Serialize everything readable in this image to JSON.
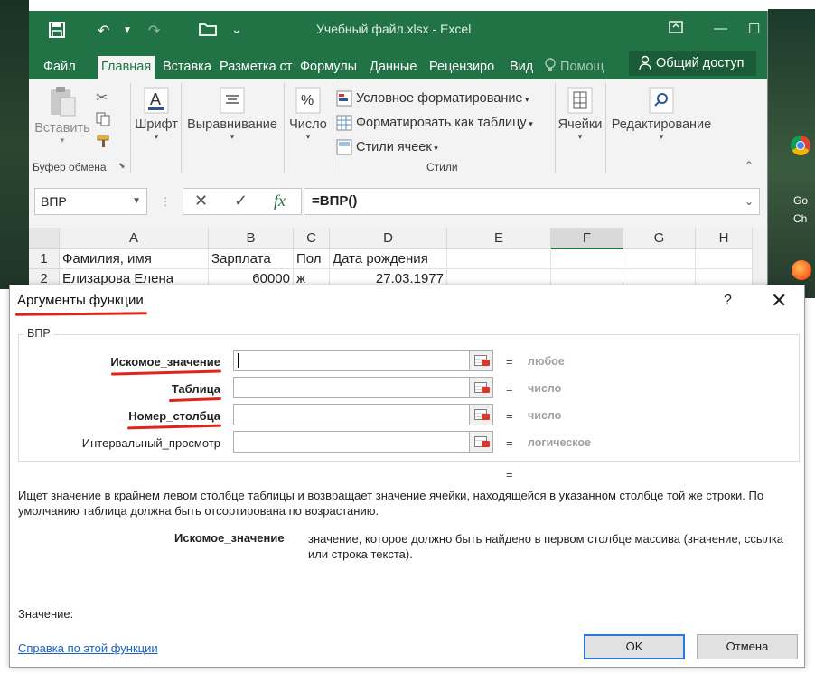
{
  "excel": {
    "window_title": "Учебный файл.xlsx - Excel",
    "tabs": [
      "Файл",
      "Главная",
      "Вставка",
      "Разметка ст",
      "Формулы",
      "Данные",
      "Рецензиро",
      "Вид"
    ],
    "active_tab": "Главная",
    "tell_me": "Помощ",
    "share": "Общий доступ",
    "ribbon": {
      "paste_label": "Вставить",
      "clipboard_group": "Буфер обмена",
      "font_label": "Шрифт",
      "alignment_label": "Выравнивание",
      "number_label": "Число",
      "conditional_formatting": "Условное форматирование",
      "format_as_table": "Форматировать как таблицу",
      "cell_styles": "Стили ячеек",
      "styles_group": "Стили",
      "cells_label": "Ячейки",
      "editing_label": "Редактирование"
    },
    "name_box": "ВПР",
    "fx": "fx",
    "formula": "=ВПР()",
    "columns": [
      "A",
      "B",
      "C",
      "D",
      "E",
      "F",
      "G",
      "H"
    ],
    "selected_column": "F",
    "rows": [
      {
        "num": "1",
        "cells": [
          "Фамилия, имя",
          "Зарплата",
          "Пол",
          "Дата рождения",
          "",
          "",
          "",
          ""
        ]
      },
      {
        "num": "2",
        "cells": [
          "Елизарова Елена",
          "60000",
          "ж",
          "27.03.1977",
          "",
          "",
          "",
          ""
        ]
      }
    ]
  },
  "desktop": {
    "lines": [
      "Go",
      "Ch"
    ]
  },
  "dialog": {
    "title": "Аргументы функции",
    "help_symbol": "?",
    "close_symbol": "✕",
    "function_name": "ВПР",
    "arguments": [
      {
        "name": "Искомое_значение",
        "bold": true,
        "value": "",
        "result": "любое"
      },
      {
        "name": "Таблица",
        "bold": true,
        "value": "",
        "result": "число"
      },
      {
        "name": "Номер_столбца",
        "bold": true,
        "value": "",
        "result": "число"
      },
      {
        "name": "Интервальный_просмотр",
        "bold": false,
        "value": "",
        "result": "логическое"
      }
    ],
    "equals": "=",
    "description": "Ищет значение в крайнем левом столбце таблицы и возвращает значение ячейки, находящейся в указанном столбце той же строки. По умолчанию таблица должна быть отсортирована по возрастанию.",
    "param_name": "Искомое_значение",
    "param_description": "значение, которое должно быть найдено в первом столбце массива (значение, ссылка или строка текста).",
    "value_label": "Значение:",
    "help_link": "Справка по этой функции",
    "ok": "OK",
    "cancel": "Отмена"
  },
  "colors": {
    "excel_green": "#217346",
    "annotation_red": "#e2231a",
    "link_blue": "#1a62c3"
  }
}
